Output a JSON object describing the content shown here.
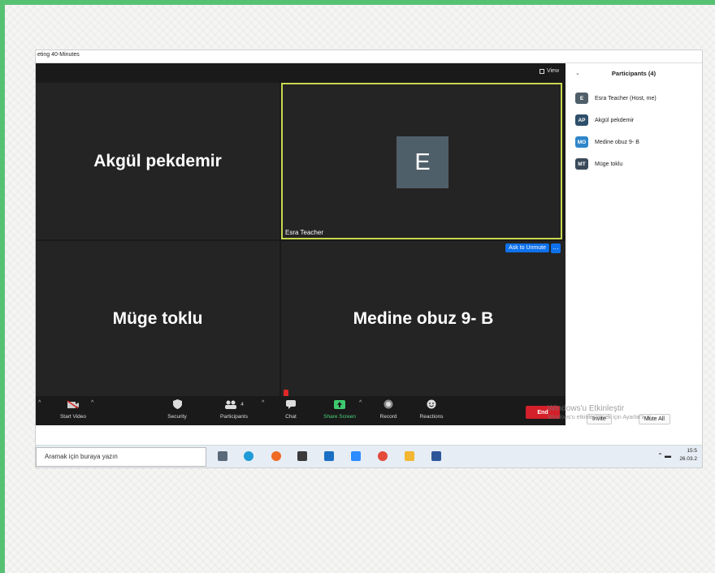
{
  "window": {
    "title": "eting 40-Minutes"
  },
  "topbar": {
    "view_label": "View"
  },
  "tiles": {
    "t1": {
      "name": "Akgül pekdemir"
    },
    "t2": {
      "avatar_letter": "E",
      "label": "Esra Teacher"
    },
    "t3": {
      "name": "Müge toklu"
    },
    "t4": {
      "name": "Medine obuz  9- B",
      "ask_label": "Ask to Unmute",
      "more_label": "···"
    }
  },
  "toolbar": {
    "start_video": "Start Video",
    "security": "Security",
    "participants": "Participants",
    "participants_count": "4",
    "chat": "Chat",
    "share_screen": "Share Screen",
    "record": "Record",
    "reactions": "Reactions",
    "end": "End"
  },
  "participants_panel": {
    "title": "Participants (4)",
    "items": [
      {
        "initials": "E",
        "name": "Esra Teacher (Host, me)",
        "color": "#4f5f6a"
      },
      {
        "initials": "AP",
        "name": "Akgül pekdemir",
        "color": "#2f4f6a"
      },
      {
        "initials": "MO",
        "name": "Medine obuz  9- B",
        "color": "#2f86c9"
      },
      {
        "initials": "MT",
        "name": "Müge toklu",
        "color": "#3a4a5a"
      }
    ],
    "invite": "Invite",
    "mute_all": "Mute All"
  },
  "watermark": {
    "line1": "Windows'u Etkinleştir",
    "line2": "Windows'u etkinleştirmek için Ayarlar'a gi"
  },
  "taskbar": {
    "search_placeholder": "Aramak için buraya yazın",
    "time": "15:5",
    "date": "26.03.2"
  },
  "colors": {
    "accent_blue": "#0e71eb",
    "end_red": "#d3202b",
    "active_border": "#c7d84f"
  }
}
